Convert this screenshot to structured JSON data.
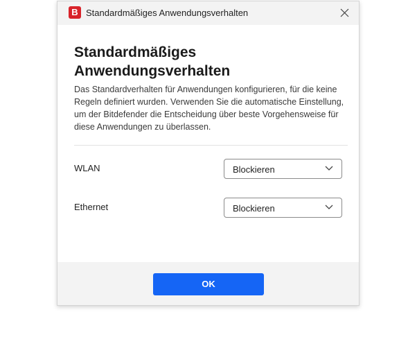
{
  "window": {
    "title": "Standardmäßiges Anwendungsverhalten",
    "app_icon_letter": "B",
    "app_icon_color": "#d8232a"
  },
  "dialog": {
    "heading_line1": "Standardmäßiges",
    "heading_line2": "Anwendungsverhalten",
    "description": "Das Standardverhalten für Anwendungen konfigurieren, für die keine Regeln definiert wurden. Verwenden Sie die automatische Einstellung, um der Bitdefender die Entscheidung über beste Vorgehensweise für diese Anwendungen zu überlassen."
  },
  "settings": [
    {
      "label": "WLAN",
      "selected": "Blockieren"
    },
    {
      "label": "Ethernet",
      "selected": "Blockieren"
    }
  ],
  "footer": {
    "ok_label": "OK",
    "ok_color": "#1565f5"
  }
}
